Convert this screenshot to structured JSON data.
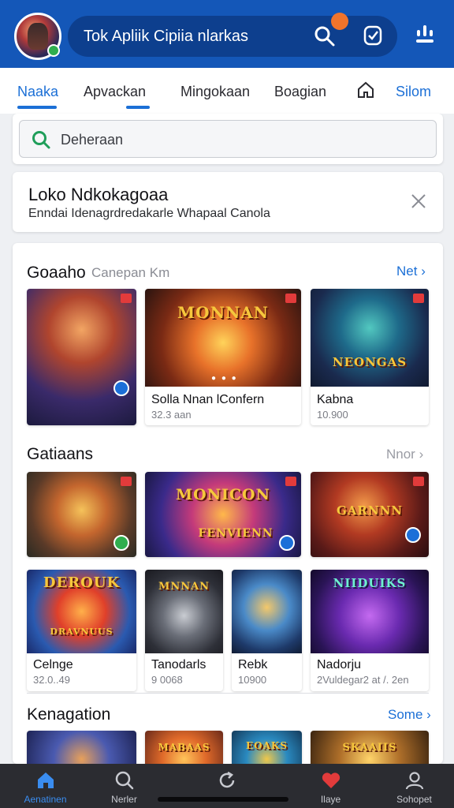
{
  "header": {
    "title": "Tok Apliik Cipiia nlarkas",
    "icons": {
      "search": "search-icon",
      "notification": "notification-icon",
      "menu": "menu-icon"
    },
    "colors": {
      "bar": "#1457b8",
      "pill": "#0d3f8e",
      "dot": "#f0742c"
    }
  },
  "tabs": {
    "items": [
      {
        "label": "Naaka"
      },
      {
        "label": "Apvackan"
      },
      {
        "label": "Mingokaan"
      },
      {
        "label": "Boagian"
      }
    ],
    "right_label": "Silom"
  },
  "search": {
    "placeholder": "Deheraan"
  },
  "info": {
    "title": "Loko Ndkokagoaa",
    "subtitle": "Enndai Idenagrdredakarle Whapaal Canola"
  },
  "sections": {
    "first": {
      "title": "Goaaho",
      "subtitle": "Canepan Km",
      "link": "Net",
      "games": [
        {
          "name": "",
          "meta": "",
          "thumb_text": ""
        },
        {
          "name": "Solla Nnan lConfern",
          "meta": "32.3 aan",
          "thumb_text": "MONNAN"
        },
        {
          "name": "Kabna",
          "meta": "10.900",
          "thumb_text": "NEONGAS"
        }
      ]
    },
    "second": {
      "title": "Gatiaans",
      "link": "Nnor",
      "row1": [
        {
          "thumb_text": ""
        },
        {
          "thumb_text": "MONICON",
          "thumb_text2": "FENVIENN"
        },
        {
          "thumb_text": "GARNNN"
        }
      ],
      "row2": [
        {
          "name": "Celnge",
          "meta": "32.0..49",
          "thumb_text": "DEROUK",
          "thumb_text2": "DRAVNUUS"
        },
        {
          "name": "Tanodarls",
          "meta": "9 0068",
          "thumb_text": "MNNAN"
        },
        {
          "name": "Rebk",
          "meta": "10900",
          "thumb_text": ""
        },
        {
          "name": "Nadorju",
          "meta": "2Vuldegar2 at /. 2en",
          "thumb_text": "NIIDUIKS"
        }
      ]
    },
    "third": {
      "title": "Kenagation",
      "link": "Some",
      "thumbs": [
        {
          "thumb_text": ""
        },
        {
          "thumb_text": "MABAAS"
        },
        {
          "thumb_text": "EOAKS"
        },
        {
          "thumb_text": "SKAAIIS"
        }
      ]
    }
  },
  "bottom_nav": {
    "items": [
      {
        "label": "Aenatinen",
        "icon": "home-icon"
      },
      {
        "label": "Nerler",
        "icon": "search-icon"
      },
      {
        "label": "",
        "icon": "refresh-icon"
      },
      {
        "label": "Ilaye",
        "icon": "heart-icon"
      },
      {
        "label": "Sohopet",
        "icon": "profile-icon"
      }
    ]
  },
  "colors": {
    "accent": "#1b6fd6",
    "bottom_bar": "#2b2c31"
  }
}
